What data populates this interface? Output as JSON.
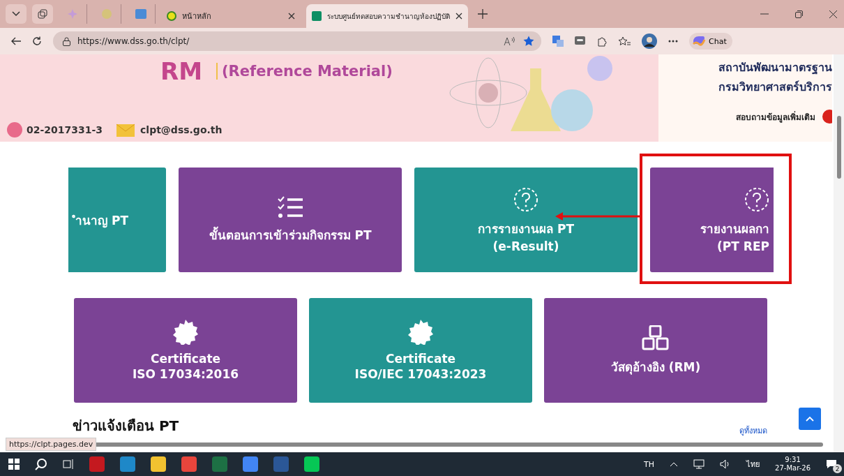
{
  "browser": {
    "tabs": [
      {
        "label": "หน้าหลัก",
        "selected": false
      },
      {
        "label": "ระบบศูนย์ทดสอบความชำนาญห้องปฏิบัติ",
        "selected": true
      }
    ],
    "address": "https://www.dss.go.th/clpt/",
    "chat_label": "Chat"
  },
  "banner": {
    "code": "RM",
    "subtitle": "(Reference Material)",
    "phone": "02-2017331-3",
    "email": "clpt@dss.go.th",
    "org_lines": [
      "สถาบันพัฒนามาตรฐาน",
      "กรมวิทยาศาสตร์บริการ"
    ],
    "contact": "สอบถามข้อมูลเพิ่มเติม"
  },
  "card_rows": [
    [
      {
        "kind": "none",
        "color": "#239592",
        "lines": [
          "ำนาญ PT"
        ]
      },
      {
        "kind": "checklist",
        "color": "#7b4395",
        "lines": [
          "ขั้นตอนการเข้าร่วมกิจกรรม PT"
        ]
      },
      {
        "kind": "question",
        "color": "#239592",
        "lines": [
          "การรายงานผล PT",
          "(e-Result)"
        ]
      },
      {
        "kind": "question",
        "color": "#7b4395",
        "lines": [
          "รายงานผลกา",
          "(PT REP"
        ]
      }
    ],
    [
      {
        "kind": "badge",
        "color": "#7b4395",
        "lines": [
          "Certificate",
          "ISO 17034:2016"
        ]
      },
      {
        "kind": "badge",
        "color": "#239592",
        "lines": [
          "Certificate",
          "ISO/IEC 17043:2023"
        ]
      },
      {
        "kind": "cubes",
        "color": "#7b4395",
        "lines": [
          "วัสดุอ้างอิง (RM)"
        ]
      }
    ]
  ],
  "news": {
    "title": "ข่าวแจ้งเตือน PT",
    "link": "ดูทั้งหมด"
  },
  "status_url": "https://clpt.pages.dev",
  "taskbar": {
    "language": "TH",
    "input": "ไทย",
    "time": "9:31",
    "date": "27-Mar-26",
    "notifications": "2"
  }
}
